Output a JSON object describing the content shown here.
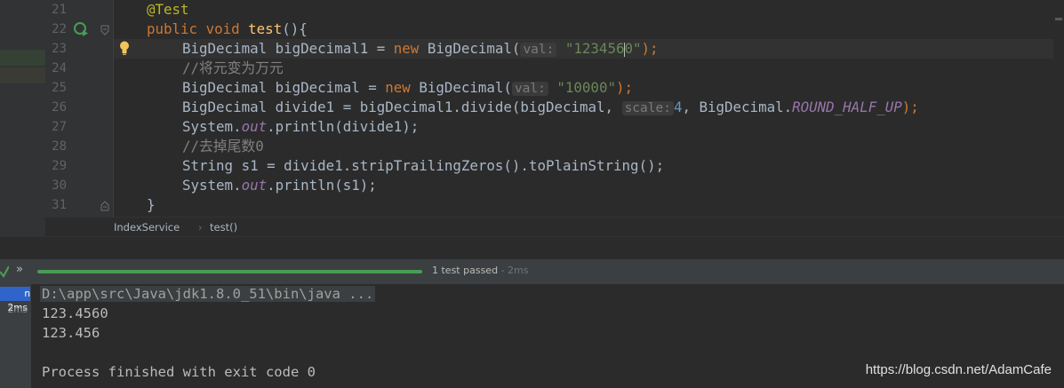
{
  "editor": {
    "line_numbers": [
      "21",
      "22",
      "23",
      "24",
      "25",
      "26",
      "27",
      "28",
      "29",
      "30",
      "31"
    ],
    "lines": {
      "l21": {
        "annotation": "@Test"
      },
      "l22": {
        "kw1": "public",
        "kw2": "void",
        "fn": "test",
        "rest": "(){"
      },
      "l23": {
        "type": "BigDecimal bigDecimal1 = ",
        "kw": "new",
        "call": " BigDecimal(",
        "hint": "val:",
        "str_a": "\"123456",
        "str_b": "0\"",
        "end": ");"
      },
      "l24": {
        "comment": "//将元变为万元"
      },
      "l25": {
        "type": "BigDecimal bigDecimal = ",
        "kw": "new",
        "call": " BigDecimal(",
        "hint": "val:",
        "str": "\"10000\"",
        "end": ");"
      },
      "l26": {
        "a": "BigDecimal divide1 = bigDecimal1.divide(bigDecimal, ",
        "hint": "scale:",
        "num": "4",
        "b": ", BigDecimal.",
        "field": "ROUND_HALF_UP",
        "end": ");"
      },
      "l27": {
        "a": "System.",
        "field": "out",
        "b": ".println(divide1);"
      },
      "l28": {
        "comment": "//去掉尾数0"
      },
      "l29": {
        "a": "String s1 = divide1.stripTrailingZeros().toPlainString();"
      },
      "l30": {
        "a": "System.",
        "field": "out",
        "b": ".println(s1);"
      },
      "l31": {
        "a": "}"
      }
    }
  },
  "breadcrumb": {
    "items": [
      "IndexService",
      "test()"
    ],
    "separator": "›"
  },
  "run": {
    "toolbar_more": "»",
    "status": "1 test passed",
    "status_dash": " - ",
    "status_duration": "2ms",
    "progress_fraction": 1.0,
    "tree": {
      "row1_label": "n 2ms",
      "row2_label": "2ms"
    },
    "console": {
      "command": "D:\\app\\src\\Java\\jdk1.8.0_51\\bin\\java ...",
      "output": [
        "123.4560",
        "123.456"
      ],
      "exit": "Process finished with exit code 0"
    }
  },
  "watermark": "https://blog.csdn.net/AdamCafe",
  "colors": {
    "background": "#2b2b2b",
    "keyword": "#cc7832",
    "string": "#6a8759",
    "annotation": "#bbb529",
    "comment": "#808080",
    "number": "#6897bb",
    "field": "#9876aa",
    "progress": "#499c54"
  },
  "icons": [
    "run-test-icon",
    "fold-icon",
    "bulb-icon",
    "run-check-icon"
  ]
}
